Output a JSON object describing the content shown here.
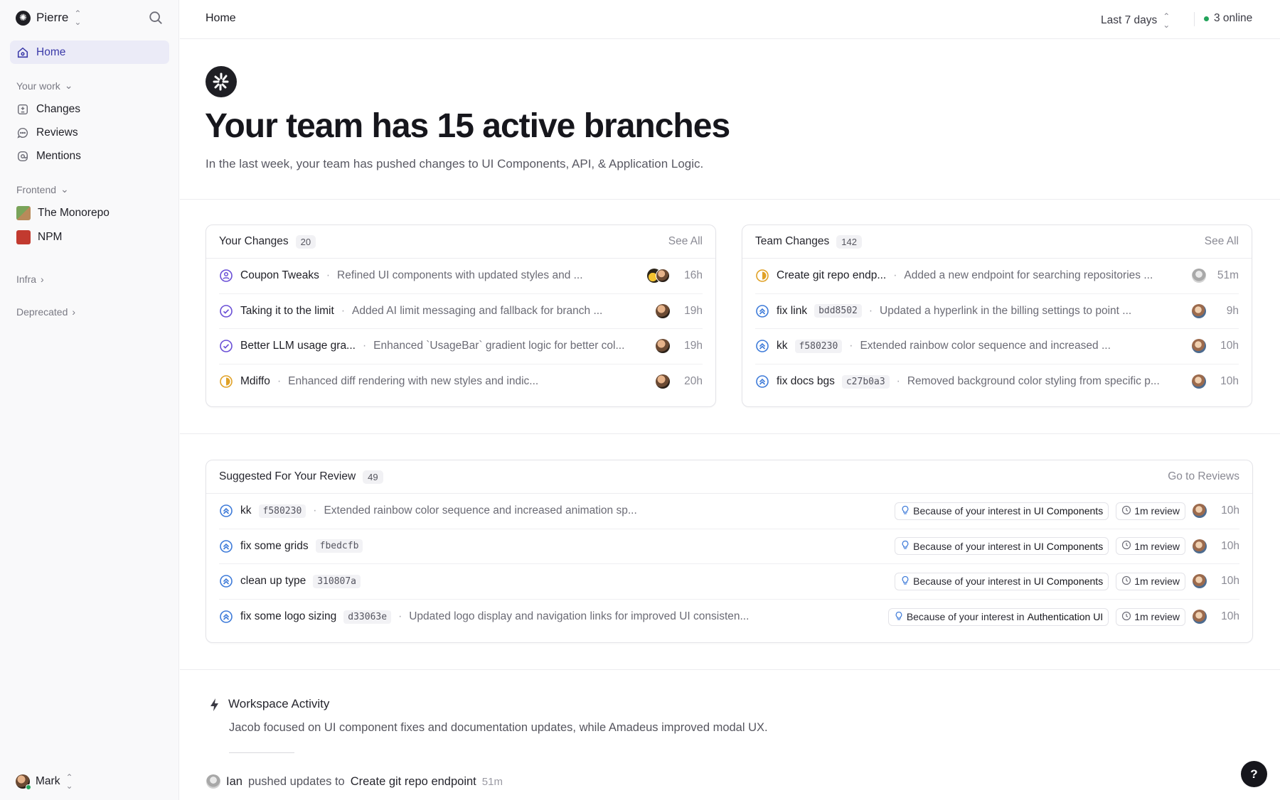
{
  "sidebar": {
    "workspace": "Pierre",
    "home": "Home",
    "your_work": {
      "label": "Your work",
      "items": [
        "Changes",
        "Reviews",
        "Mentions"
      ]
    },
    "frontend": {
      "label": "Frontend",
      "items": [
        "The Monorepo",
        "NPM"
      ]
    },
    "infra": "Infra",
    "deprecated": "Deprecated",
    "user": "Mark"
  },
  "topbar": {
    "breadcrumb": "Home",
    "range": "Last 7 days",
    "online": "3 online"
  },
  "hero": {
    "title": "Your team has 15 active branches",
    "subtitle": "In the last week, your team has pushed changes to UI Components, API, & Application Logic."
  },
  "your_changes": {
    "title": "Your Changes",
    "count": "20",
    "see_all": "See All",
    "rows": [
      {
        "title": "Coupon Tweaks",
        "sha": "",
        "desc": "Refined UI components with updated styles and ...",
        "age": "16h",
        "status": "review"
      },
      {
        "title": "Taking it to the limit",
        "sha": "",
        "desc": "Added AI limit messaging and fallback for branch ...",
        "age": "19h",
        "status": "done"
      },
      {
        "title": "Better LLM usage gra...",
        "sha": "",
        "desc": "Enhanced `UsageBar` gradient logic for better col...",
        "age": "19h",
        "status": "done"
      },
      {
        "title": "Mdiffo",
        "sha": "",
        "desc": "Enhanced diff rendering with new styles and indic...",
        "age": "20h",
        "status": "half"
      }
    ]
  },
  "team_changes": {
    "title": "Team Changes",
    "count": "142",
    "see_all": "See All",
    "rows": [
      {
        "title": "Create git repo endp...",
        "sha": "",
        "desc": "Added a new endpoint for searching repositories ...",
        "age": "51m",
        "status": "half"
      },
      {
        "title": "fix link",
        "sha": "bdd8502",
        "desc": "Updated a hyperlink in the billing settings to point ...",
        "age": "9h",
        "status": "merge"
      },
      {
        "title": "kk",
        "sha": "f580230",
        "desc": "Extended rainbow color sequence and increased ...",
        "age": "10h",
        "status": "merge"
      },
      {
        "title": "fix docs bgs",
        "sha": "c27b0a3",
        "desc": "Removed background color styling from specific p...",
        "age": "10h",
        "status": "merge"
      }
    ]
  },
  "suggested": {
    "title": "Suggested For Your Review",
    "count": "49",
    "go": "Go to Reviews",
    "reason_prefix": "Because of your interest in",
    "review_time": "1m review",
    "rows": [
      {
        "title": "kk",
        "sha": "f580230",
        "desc": "Extended rainbow color sequence and increased animation sp...",
        "interest": "UI Components",
        "age": "10h"
      },
      {
        "title": "fix some grids",
        "sha": "fbedcfb",
        "desc": "",
        "interest": "UI Components",
        "age": "10h"
      },
      {
        "title": "clean up type",
        "sha": "310807a",
        "desc": "",
        "interest": "UI Components",
        "age": "10h"
      },
      {
        "title": "fix some logo sizing",
        "sha": "d33063e",
        "desc": "Updated logo display and navigation links for improved UI consisten...",
        "interest": "Authentication UI",
        "age": "10h"
      }
    ]
  },
  "activity": {
    "title": "Workspace Activity",
    "summary": "Jacob focused on UI component fixes and documentation updates, while Amadeus improved modal UX.",
    "event_user": "Ian",
    "event_text": "pushed updates to",
    "event_target": "Create git repo endpoint",
    "event_age": "51m"
  },
  "help": "?",
  "colors": {
    "accent": "#5b4fd6",
    "review": "#6a4fd6",
    "merge": "#3e7bd9",
    "half": "#e0a126",
    "online": "#22a35a"
  }
}
